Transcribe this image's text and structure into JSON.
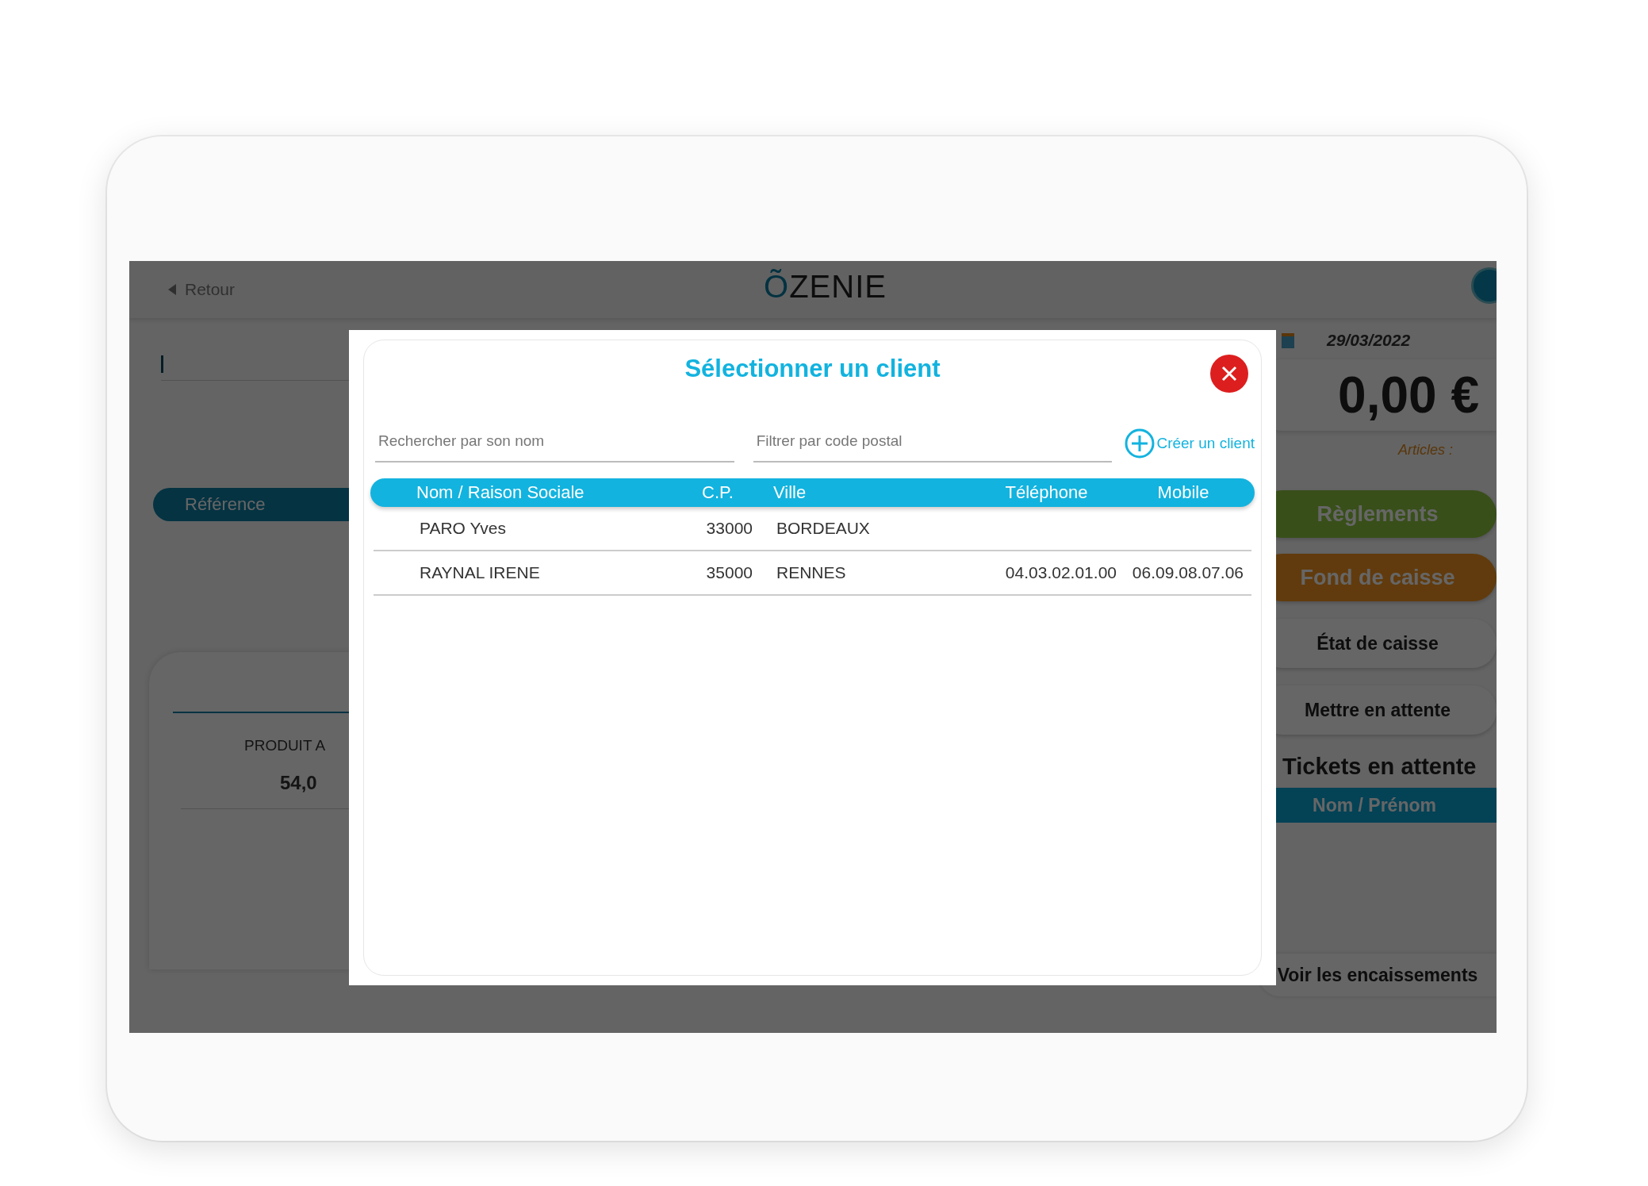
{
  "app_bar": {
    "back": "Retour",
    "logo": "ÕZENIE"
  },
  "main": {
    "reference_tab": "Référence",
    "product": {
      "name": "PRODUIT A",
      "price": "54,0"
    }
  },
  "side_panel": {
    "date": "29/03/2022",
    "total": "0,00 €",
    "articles_label": "Articles :",
    "buttons": [
      {
        "label": "Règlements",
        "kind": "green"
      },
      {
        "label": "Fond de caisse",
        "kind": "orange"
      },
      {
        "label": "État de caisse",
        "kind": "plain"
      },
      {
        "label": "Mettre en attente",
        "kind": "plain"
      }
    ],
    "waiting_title": "Tickets en attente",
    "waiting_column": "Nom / Prénom",
    "footer_button": "Voir les encaissements"
  },
  "dialog": {
    "title": "Sélectionner un client",
    "search": {
      "placeholder": "Rechercher par son nom"
    },
    "postal_filter": {
      "placeholder": "Filtrer par code postal"
    },
    "create_link": "Créer un client",
    "table": {
      "columns": [
        "Nom / Raison Sociale",
        "C.P.",
        "Ville",
        "Téléphone",
        "Mobile"
      ],
      "rows": [
        [
          "PARO Yves",
          "33000",
          "BORDEAUX",
          "",
          ""
        ],
        [
          "RAYNAL IRENE",
          "35000",
          "RENNES",
          "04.03.02.01.00",
          "06.09.08.07.06"
        ]
      ]
    }
  }
}
